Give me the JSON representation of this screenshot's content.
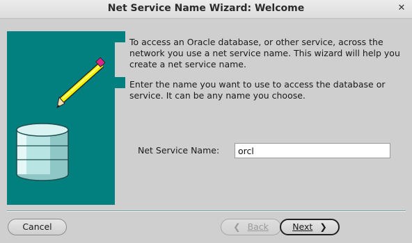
{
  "window": {
    "title": "Net Service Name Wizard: Welcome",
    "close_glyph": "✕"
  },
  "intro": {
    "paragraph1": "To access an Oracle database, or other service, across the network you use a net service name.  This wizard will help you create a net service name.",
    "paragraph2": "Enter the name you want to use to access the database or service.  It can be any name you choose."
  },
  "form": {
    "net_service_name_label": "Net Service Name:",
    "net_service_name_value": "orcl"
  },
  "buttons": {
    "cancel": "Cancel",
    "back_arrow": "❮",
    "back": "Back",
    "next": "Next",
    "next_arrow": "❯"
  },
  "colors": {
    "teal": "#028080",
    "window_bg": "#cfcfcf"
  },
  "icons": {
    "art": "database-and-pencil-illustration"
  }
}
